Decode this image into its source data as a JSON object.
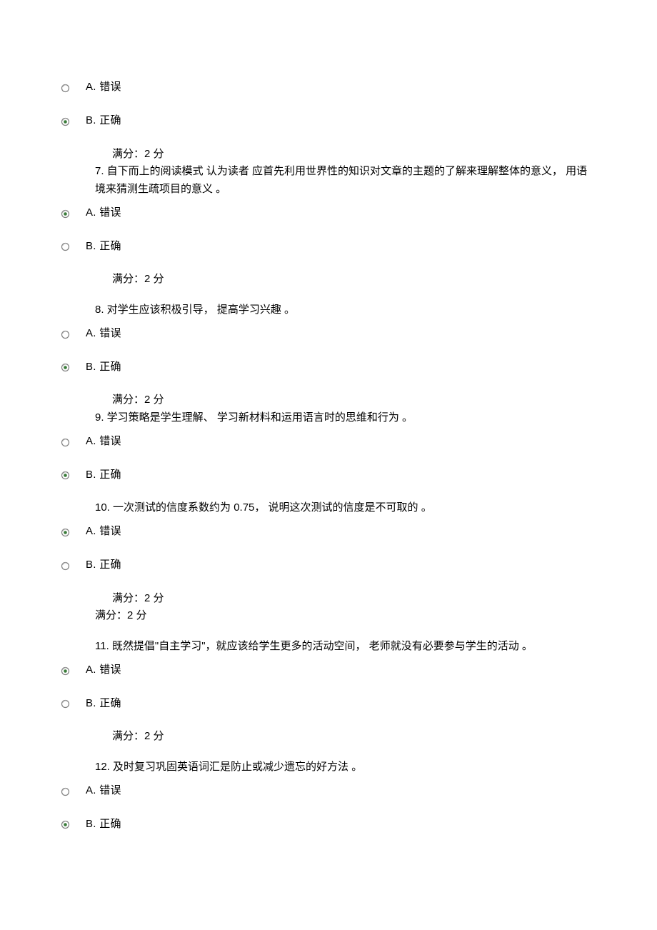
{
  "options": {
    "a_label": "A. 错误",
    "b_label": "B. 正确"
  },
  "score_label": "满分：2  分",
  "questions": {
    "q7": "7.  自下而上的阅读模式  认为读者  应首先利用世界性的知识对文章的主题的了解来理解整体的意义，  用语境来猜测生疏项目的意义  。",
    "q8": "8.  对学生应该积极引导，  提高学习兴趣  。",
    "q9": "9.  学习策略是学生理解、  学习新材料和运用语言时的思维和行为  。",
    "q10": "10.  一次测试的信度系数约为 0.75，  说明这次测试的信度是不可取的  。",
    "q11": "11.  既然提倡\"自主学习\"，就应该给学生更多的活动空间，  老师就没有必要参与学生的活动  。",
    "q12": "12.  及时复习巩固英语词汇是防止或减少遗忘的好方法  。"
  }
}
